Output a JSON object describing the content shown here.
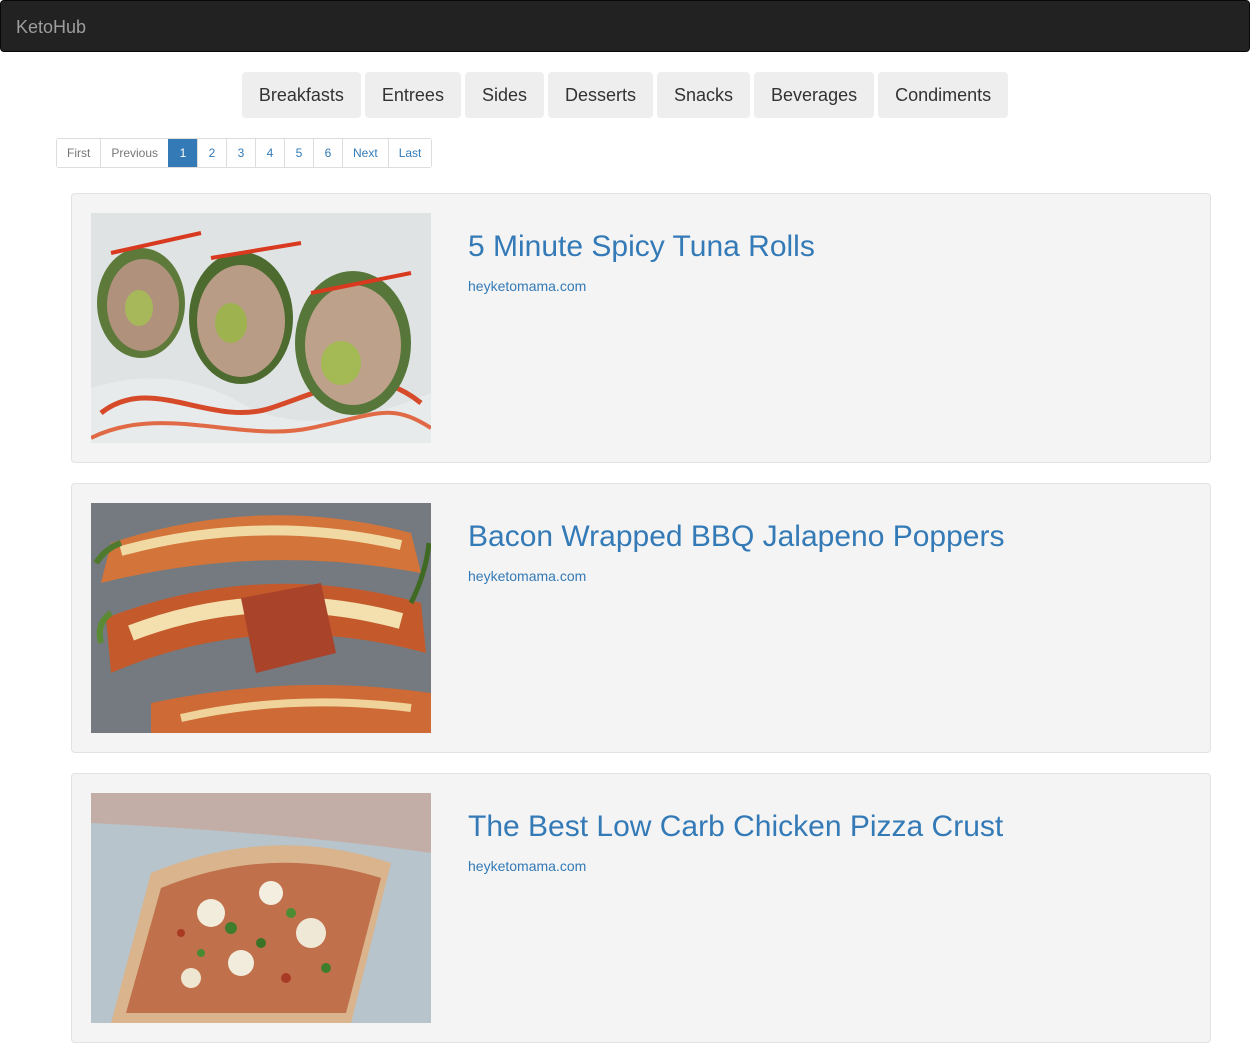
{
  "navbar": {
    "brand": "KetoHub"
  },
  "categories": [
    "Breakfasts",
    "Entrees",
    "Sides",
    "Desserts",
    "Snacks",
    "Beverages",
    "Condiments"
  ],
  "pagination": {
    "first": "First",
    "previous": "Previous",
    "pages": [
      "1",
      "2",
      "3",
      "4",
      "5",
      "6"
    ],
    "current": "1",
    "next": "Next",
    "last": "Last"
  },
  "recipes": [
    {
      "title": "5 Minute Spicy Tuna Rolls",
      "source": "heyketomama.com",
      "image": "spicy-tuna-rolls-photo"
    },
    {
      "title": "Bacon Wrapped BBQ Jalapeno Poppers",
      "source": "heyketomama.com",
      "image": "jalapeno-poppers-photo"
    },
    {
      "title": "The Best Low Carb Chicken Pizza Crust",
      "source": "heyketomama.com",
      "image": "chicken-pizza-crust-photo"
    }
  ]
}
